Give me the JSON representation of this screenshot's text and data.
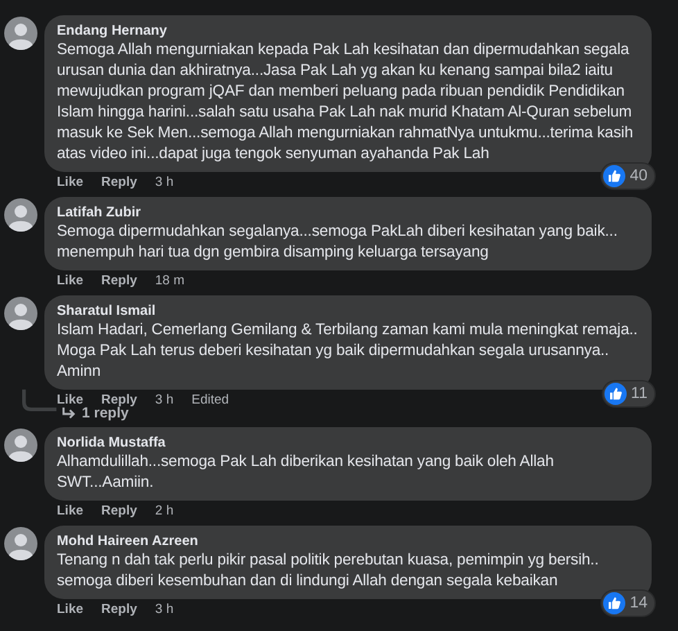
{
  "comments": [
    {
      "author": "Endang Hernany",
      "text": "Semoga Allah mengurniakan kepada Pak Lah kesihatan dan dipermudahkan segala urusan dunia dan akhiratnya...Jasa Pak Lah yg akan ku kenang sampai bila2 iaitu mewujudkan program jQAF dan memberi peluang pada ribuan pendidik Pendidikan Islam hingga harini...salah satu usaha Pak Lah nak murid Khatam Al-Quran sebelum masuk ke Sek Men...semoga Allah mengurniakan rahmatNya untukmu...terima kasih atas video ini...dapat juga tengok senyuman ayahanda Pak Lah",
      "like": "Like",
      "reply": "Reply",
      "time": "3 h",
      "reactions": "40"
    },
    {
      "author": "Latifah Zubir",
      "text": "Semoga dipermudahkan segalanya...semoga PakLah diberi kesihatan yang baik... menempuh hari tua dgn gembira disamping keluarga tersayang",
      "like": "Like",
      "reply": "Reply",
      "time": "18 m"
    },
    {
      "author": "Sharatul Ismail",
      "text": "Islam Hadari, Cemerlang Gemilang & Terbilang zaman kami mula meningkat remaja.. Moga Pak Lah terus deberi kesihatan yg baik dipermudahkan segala urusannya.. Aminn",
      "like": "Like",
      "reply": "Reply",
      "time": "3 h",
      "edited": "Edited",
      "reactions": "11",
      "replies_link": "1 reply"
    },
    {
      "author": "Norlida Mustaffa",
      "text": "Alhamdulillah...semoga Pak Lah diberikan kesihatan yang baik oleh Allah SWT...Aamiin.",
      "like": "Like",
      "reply": "Reply",
      "time": "2 h"
    },
    {
      "author": "Mohd Haireen Azreen",
      "text": "Tenang n dah tak perlu pikir pasal politik perebutan kuasa, pemimpin yg bersih.. semoga diberi kesembuhan dan di lindungi Allah dengan segala kebaikan",
      "like": "Like",
      "reply": "Reply",
      "time": "3 h",
      "reactions": "14"
    }
  ]
}
